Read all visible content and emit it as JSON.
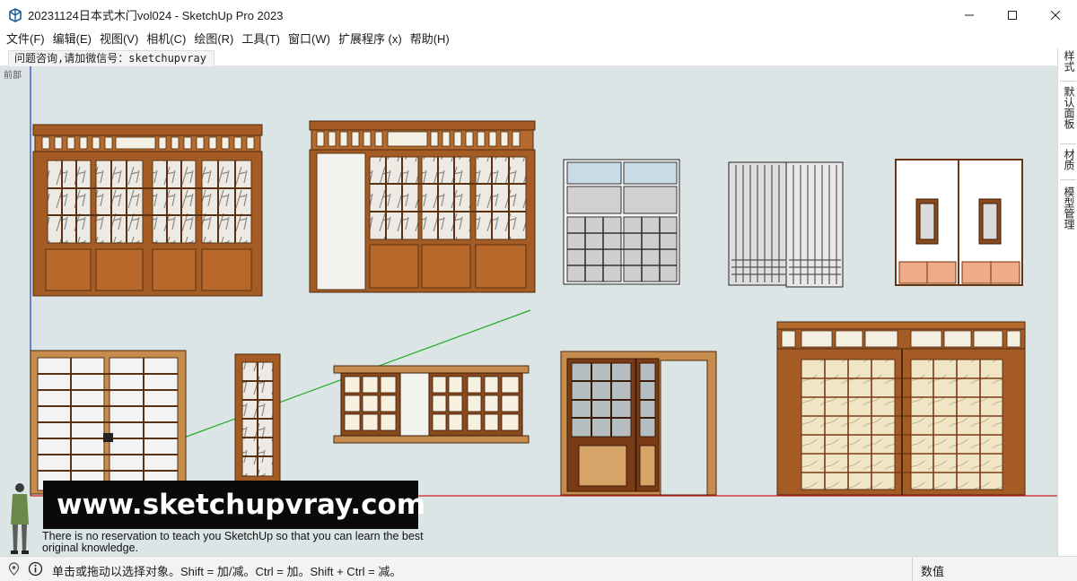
{
  "window": {
    "title": "20231124日本式木门vol024 - SketchUp Pro 2023",
    "icon": "sketchup-logo-icon",
    "controls": [
      "minimize-icon",
      "maximize-icon",
      "close-icon"
    ]
  },
  "menubar": {
    "items": [
      "文件(F)",
      "编辑(E)",
      "视图(V)",
      "相机(C)",
      "绘图(R)",
      "工具(T)",
      "窗口(W)",
      "扩展程序 (x)",
      "帮助(H)"
    ]
  },
  "toolbar": {
    "message": "问题咨询,请加微信号：sketchupvray"
  },
  "tray": {
    "tabs": [
      "样式",
      "默认面板",
      "材质",
      "模型管理"
    ]
  },
  "viewport": {
    "scene_label": "前部",
    "banner_text": "www.sketchupvray.com",
    "caption": "There is no reservation to teach you SketchUp so that you can learn  the best original knowledge.",
    "colors": {
      "background": "#dce5e6",
      "wood": "#a65a22",
      "wood_dark": "#6b3510",
      "paper": "#f2efe4",
      "axis_red": "#cc2222",
      "axis_green": "#22aa22",
      "axis_blue": "#2233cc"
    }
  },
  "statusbar": {
    "geo_icon": "geolocation-icon",
    "info_icon": "info-icon",
    "hint": "单击或拖动以选择对象。Shift = 加/减。Ctrl = 加。Shift + Ctrl = 减。",
    "value_label": "数值"
  }
}
